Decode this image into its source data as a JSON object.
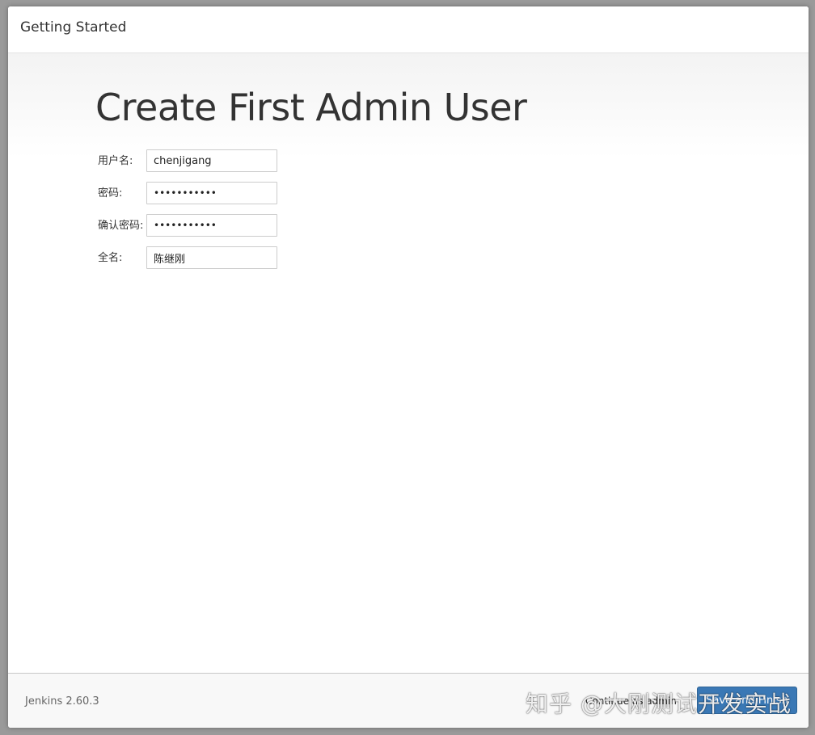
{
  "header": {
    "title": "Getting Started"
  },
  "main": {
    "heading": "Create First Admin User",
    "fields": [
      {
        "label": "用户名:",
        "value": "chenjigang",
        "type": "text"
      },
      {
        "label": "密码:",
        "value": "•••••••••••",
        "type": "password"
      },
      {
        "label": "确认密码:",
        "value": "•••••••••••",
        "type": "password"
      },
      {
        "label": "全名:",
        "value": "陈继刚",
        "type": "text"
      }
    ]
  },
  "footer": {
    "version": "Jenkins 2.60.3",
    "continue_as_admin_label": "Continue as admin",
    "save_and_finish_label": "Save and Finish"
  },
  "watermark": {
    "text": "知乎 @大刚测试开发实战"
  }
}
